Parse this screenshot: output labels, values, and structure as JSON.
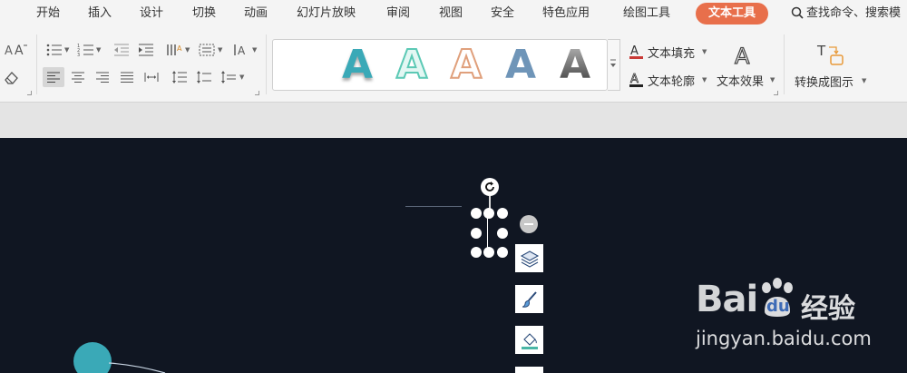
{
  "menu": {
    "tabs": [
      "开始",
      "插入",
      "设计",
      "切换",
      "动画",
      "幻灯片放映",
      "审阅",
      "视图",
      "安全",
      "特色应用",
      "绘图工具"
    ],
    "active_tab": "文本工具",
    "search_text": "查找命令、搜索模"
  },
  "ribbon": {
    "text_fill_label": "文本填充",
    "text_outline_label": "文本轮廓",
    "text_effect_label": "文本效果",
    "convert_label": "转换成图示",
    "gallery_glyph": "A"
  },
  "colors": {
    "accent": "#e86f4b",
    "canvas": "#101622",
    "teal": "#3aa9b7"
  },
  "watermark": {
    "brand": "Bai",
    "brand2": "du",
    "cn": "经验",
    "url": "jingyan.baidu.com"
  }
}
